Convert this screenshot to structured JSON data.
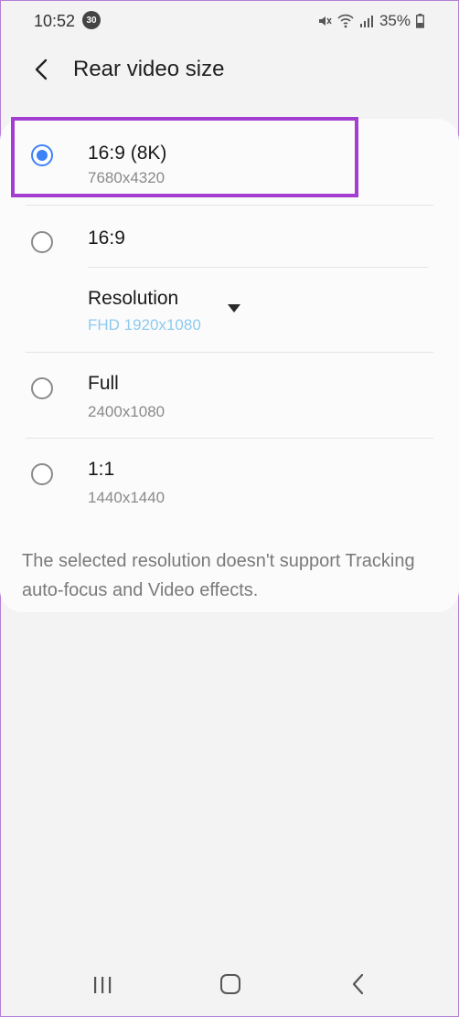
{
  "status": {
    "time": "10:52",
    "notification_count": "30",
    "battery": "35%"
  },
  "header": {
    "title": "Rear video size"
  },
  "options": [
    {
      "title": "16:9 (8K)",
      "subtitle": "7680x4320",
      "selected": true
    },
    {
      "title": "16:9",
      "selected": false,
      "resolution_label": "Resolution",
      "resolution_value": "FHD 1920x1080"
    },
    {
      "title": "Full",
      "subtitle": "2400x1080",
      "selected": false
    },
    {
      "title": "1:1",
      "subtitle": "1440x1440",
      "selected": false
    }
  ],
  "note": "The selected resolution doesn't support Tracking auto-focus and Video effects.",
  "colors": {
    "accent": "#3e82f7",
    "highlight": "#a43dd1",
    "resolution_value": "#8ecbf0"
  }
}
